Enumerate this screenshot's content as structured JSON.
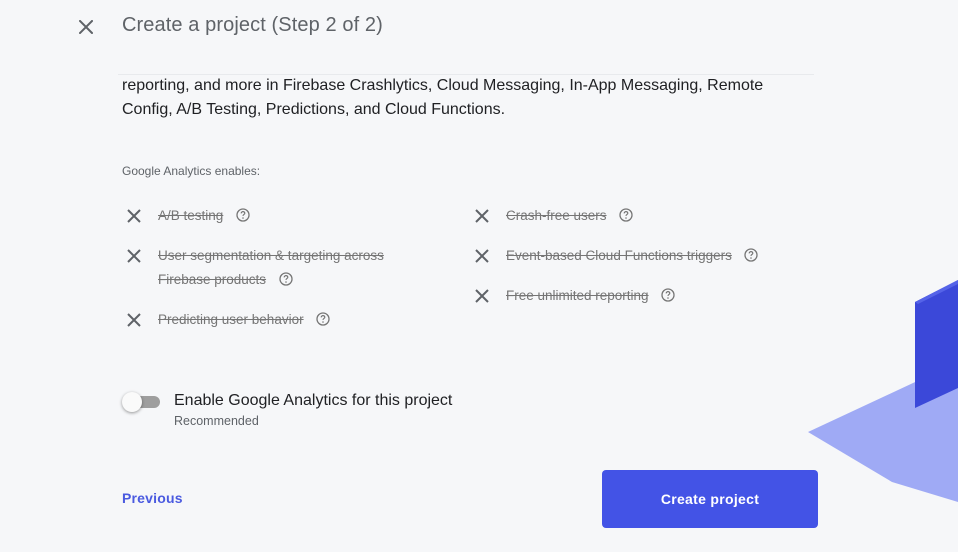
{
  "header": {
    "title": "Create a project (Step 2 of 2)",
    "close_icon": "close-icon"
  },
  "intro": {
    "text": "reporting, and more in Firebase Crashlytics, Cloud Messaging, In-App Messaging, Remote Config, A/B Testing, Predictions, and Cloud Functions."
  },
  "analytics": {
    "heading": "Google Analytics enables:",
    "features_left": [
      {
        "label": "A/B testing",
        "icon": "x-icon",
        "help_icon": "help-circle-icon"
      },
      {
        "label": "User segmentation & targeting across Firebase products",
        "icon": "x-icon",
        "help_icon": "help-circle-icon"
      },
      {
        "label": "Predicting user behavior",
        "icon": "x-icon",
        "help_icon": "help-circle-icon"
      }
    ],
    "features_right": [
      {
        "label": "Crash-free users",
        "icon": "x-icon",
        "help_icon": "help-circle-icon"
      },
      {
        "label": "Event-based Cloud Functions triggers",
        "icon": "x-icon",
        "help_icon": "help-circle-icon"
      },
      {
        "label": "Free unlimited reporting",
        "icon": "x-icon",
        "help_icon": "help-circle-icon"
      }
    ]
  },
  "toggle": {
    "label": "Enable Google Analytics for this project",
    "sublabel": "Recommended",
    "enabled": false
  },
  "footer": {
    "previous_label": "Previous",
    "create_label": "Create project"
  },
  "colors": {
    "primary": "#4353e6",
    "link": "#4a5ae0",
    "background": "#f6f7f9",
    "deco_light": "#8f9cf5",
    "deco_dark": "#3b48d9"
  }
}
